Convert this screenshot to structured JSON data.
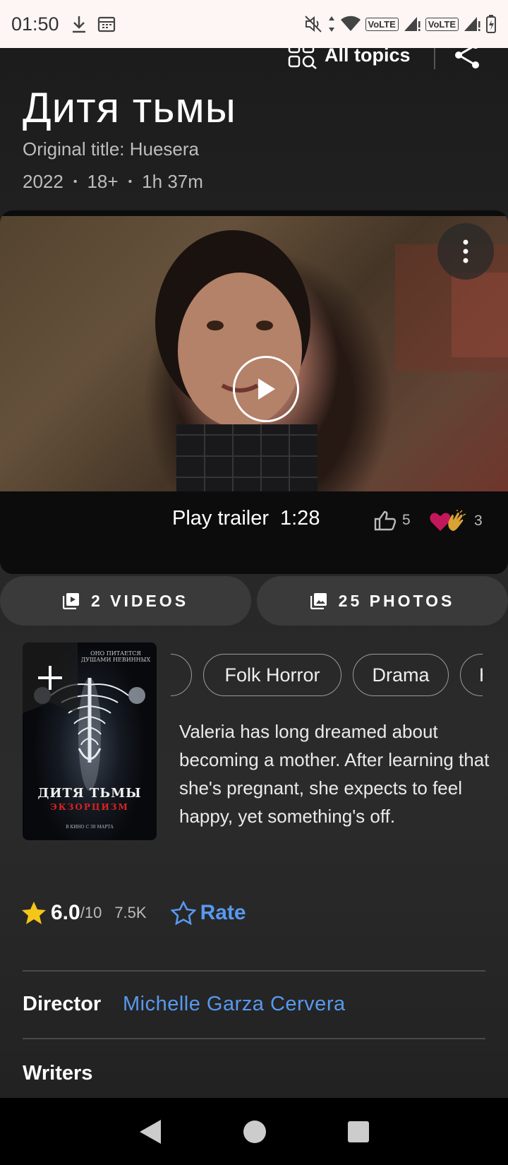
{
  "status_bar": {
    "time": "01:50",
    "volte_1": "VoLTE",
    "volte_2": "VoLTE"
  },
  "header": {
    "all_topics_label": "All topics"
  },
  "movie": {
    "title": "Дитя тьмы",
    "original_title": "Original title: Huesera",
    "year": "2022",
    "age_rating": "18+",
    "runtime": "1h 37m"
  },
  "trailer": {
    "label": "Play trailer",
    "duration": "1:28",
    "likes": "5",
    "reactions": "3"
  },
  "media": {
    "videos_label": "2 VIDEOS",
    "photos_label": "25 PHOTOS"
  },
  "poster": {
    "tagline": "ОНО ПИТАЕТСЯ ДУШАМИ НЕВИННЫХ",
    "title": "ДИТЯ ТЬМЫ",
    "subtitle": "ЭКЗОРЦИЗМ",
    "release": "В КИНО С 30 МАРТА"
  },
  "genres": [
    "Folk Horror",
    "Drama",
    "H"
  ],
  "description": "Valeria has long dreamed about becoming a mother. After learning that she's pregnant, she expects to feel happy, yet something's off.",
  "rating": {
    "value": "6.0",
    "max": "/10",
    "count": "7.5K",
    "rate_label": "Rate"
  },
  "credits": {
    "director_label": "Director",
    "director_name": "Michelle Garza Cervera",
    "writers_label": "Writers"
  },
  "colors": {
    "accent_blue": "#5799ef",
    "star_yellow": "#f5c518",
    "heart_pink": "#c2185b"
  }
}
